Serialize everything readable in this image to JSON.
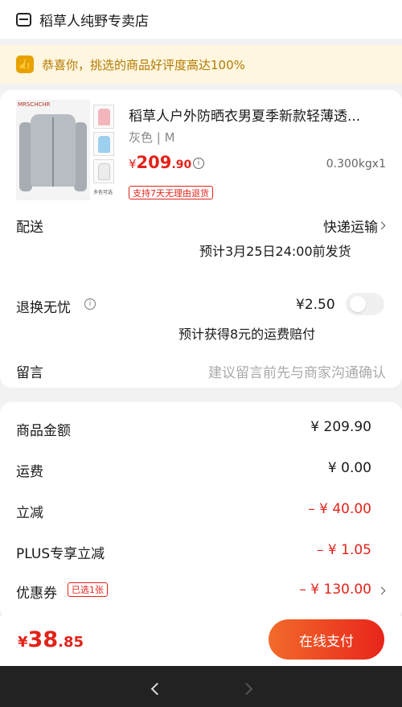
{
  "shop": {
    "name": "稻草人纯野专卖店",
    "icon": "shop-icon"
  },
  "notice": {
    "text": "恭喜你，挑选的商品好评度高达100%",
    "icon": "thumbs-up-icon"
  },
  "product": {
    "title": "稻草人户外防晒衣男夏季新款轻薄透...",
    "variant": "灰色 | M",
    "price_symbol": "¥",
    "price_int": "209",
    "price_dec": ".90",
    "weight_qty": "0.300kgx1",
    "return_tag": "支持7天无理由退货",
    "image_brand": "MRSCHCHR",
    "swatch_caption": "多色可选",
    "swatch_colors": [
      "#f4b6bd",
      "#9dd0ee",
      "#ececec"
    ]
  },
  "delivery": {
    "label": "配送",
    "method": "快递运输",
    "estimate": "预计3月25日24:00前发货"
  },
  "return_worry_free": {
    "label": "退换无忧",
    "price": "¥2.50",
    "note": "预计获得8元的运费赔付",
    "toggle_on": false
  },
  "message": {
    "label": "留言",
    "placeholder": "建议留言前先与商家沟通确认"
  },
  "summary": {
    "goods_amount": {
      "label": "商品金额",
      "value": "¥ 209.90"
    },
    "shipping": {
      "label": "运费",
      "value": "¥ 0.00"
    },
    "instant_discount": {
      "label": "立减",
      "value": "– ¥ 40.00"
    },
    "plus_discount": {
      "label": "PLUS专享立减",
      "value": "– ¥ 1.05"
    },
    "coupon": {
      "label": "优惠券",
      "tag": "已选1张",
      "value": "– ¥ 130.00"
    }
  },
  "footer": {
    "total_symbol": "¥",
    "total_int": "38",
    "total_dec": ".85",
    "pay_label": "在线支付"
  },
  "colors": {
    "accent_red": "#e2231a",
    "notice_bg": "#fff6e0",
    "notice_text": "#b37a00",
    "pay_gradient_start": "#f26b2a",
    "pay_gradient_end": "#e8251c"
  }
}
